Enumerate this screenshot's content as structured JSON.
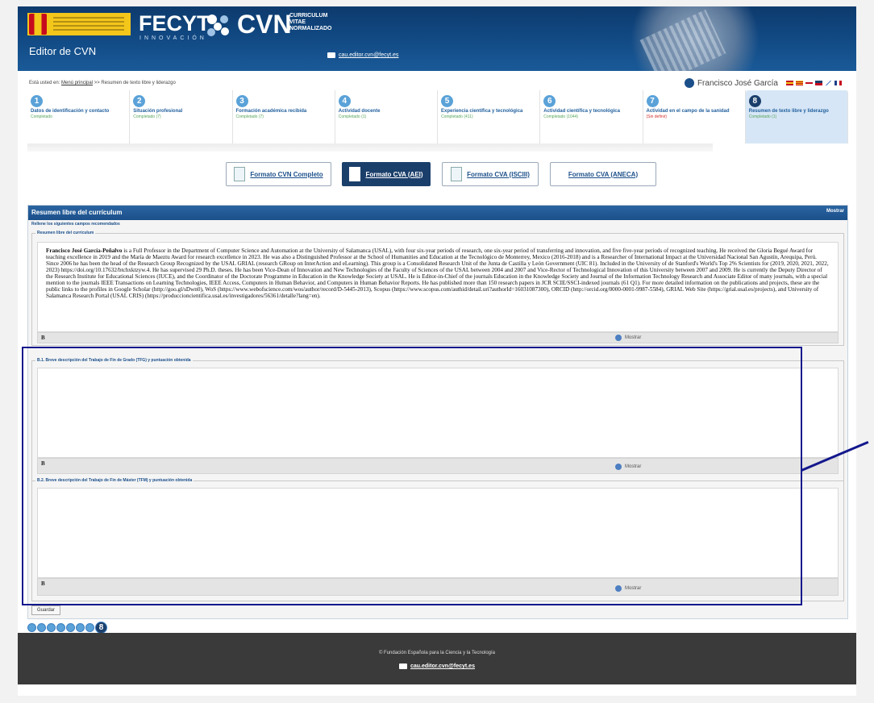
{
  "header": {
    "fecyt": "FECYT",
    "fecyt_sub": "INNOVACIÓN",
    "cvn": "CVN",
    "cvn_sub": "CURRICULUM VITAE NORMALIZADO",
    "app_title": "Editor de CVN",
    "email": "cau.editor.cvn@fecyt.es"
  },
  "breadcrumb": {
    "prefix": "Está usted en:",
    "home": "Menú principal",
    "sep": ">>",
    "current": "Resumen de texto libre y liderazgo"
  },
  "user": {
    "name": "Francisco José García"
  },
  "steps": [
    {
      "num": "1",
      "label": "Datos de identificación y contacto",
      "status": "Completado"
    },
    {
      "num": "2",
      "label": "Situación profesional",
      "status": "Completado (7)"
    },
    {
      "num": "3",
      "label": "Formación académica recibida",
      "status": "Completado (7)"
    },
    {
      "num": "4",
      "label": "Actividad docente",
      "status": "Completado (1)"
    },
    {
      "num": "5",
      "label": "Experiencia científica y tecnológica",
      "status": "Completado (411)"
    },
    {
      "num": "6",
      "label": "Actividad científica y tecnológica",
      "status": "Completado (1044)"
    },
    {
      "num": "7",
      "label": "Actividad en el campo de la sanidad",
      "status": "(Sin definir)"
    },
    {
      "num": "8",
      "label": "Resumen de texto libre y liderazgo",
      "status": "Completado (1)"
    }
  ],
  "formats": {
    "cvn": "Formato CVN Completo",
    "aei": "Formato CVA (AEI)",
    "isciii": "Formato CVA (ISCIII)",
    "aneca": "Formato CVA (ANECA)"
  },
  "panel": {
    "title": "Resumen libre del currículum",
    "mostrar": "Mostrar",
    "legend": "Rellene los siguientes campos recomendados",
    "section_a": "Resumen libre del currículum",
    "bio_name": "Francisco José García-Peñalvo",
    "bio_text": " is a Full Professor in the Department of Computer Science and Automation at the University of Salamanca (USAL), with four six-year periods of research, one six-year period of transferring and innovation, and five five-year periods of recognized teaching. He received the Gloria Begué Award for teaching excellence in 2019 and the María de Maeztu Award for research excellence in 2023. He was also a Distinguished Professor at the School of Humanities and Education at the Tecnológico de Monterrey, Mexico (2016-2018) and is a Researcher of International Impact at the Universidad Nacional San Agustín, Arequipa, Perú. Since 2006 he has been the head of the Research Group Recognized by the USAL GRIAL (research GRoup on InterAction and eLearning). This group is a Consolidated Research Unit of the Junta de Castilla y León Government (UIC 81). Included in the University of de Stanford's World's Top 2% Scientists for (2019, 2020, 2021, 2022, 2023) https://doi.org/10.17632/btchxktzyw.4. He has supervised 29 Ph.D. theses. He has been Vice-Dean of Innovation and New Technologies of the Faculty of Sciences of the USAL between 2004 and 2007 and Vice-Rector of Technological Innovation of this University between 2007 and 2009. He is currently the Deputy Director of the Research Institute for Educational Sciences (IUCE), and the Coordinator of the Doctorate Programme in Education in the Knowledge Society at USAL. He is Editor-in-Chief of the journals Education in the Knowledge Society and Journal of the Information Technology Research and Associate Editor of many journals, with a special mention to the journals IEEE Transactions on Learning Technologies, IEEE Access, Computers in Human Behavior, and Computers in Human Behavior Reports. He has published more than 150 research papers in JCR SCIE/SSCI-indexed journals (61 Q1). For more detailed information on the publications and projects, these are the public links to the profiles in Google Scholar (http://goo.gl/sDwn0), WoS (https://www.webofscience.com/wos/author/record/D-5445-2013), Scopus (https://www.scopus.com/authid/detail.uri?authorId=16031087300), ORCID (http://orcid.org/0000-0001-9987-5584), GRIAL Web Site (https://grial.usal.es/projects), and University of Salamanca Research Portal (USAL CRIS) (https://produccioncientifica.usal.es/investigadores/56361/detalle?lang=en).",
    "section_b1": "B.1. Breve descripción del Trabajo de Fin de Grado (TFG) y puntuación obtenida",
    "section_b2": "B.2. Breve descripción del Trabajo de Fin de Máster (TFM) y puntuación obtenida",
    "bold_btn": "B",
    "show1": "Mostrar",
    "show2": "Mostrar",
    "show3": "Mostrar",
    "guardar": "Guardar"
  },
  "mini_current": "8",
  "footer": {
    "copyright": "© Fundación Española para la Ciencia y la Tecnología",
    "email": "cau.editor.cvn@fecyt.es"
  },
  "colors": {
    "brand": "#1b4f8a",
    "annotation": "#13188c",
    "footer": "#3a3a3a"
  }
}
